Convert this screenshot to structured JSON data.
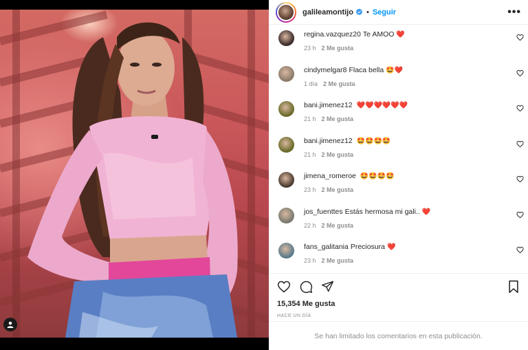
{
  "post": {
    "username": "galileamontijo",
    "separator": "•",
    "follow_label": "Seguir",
    "more_label": "•••"
  },
  "comments": [
    {
      "user": "regina.vazquez20",
      "text": "Te AMOO",
      "emoji": "❤️",
      "time": "23 h",
      "likes": "2 Me gusta",
      "avatar_color": "#3b2a2a"
    },
    {
      "user": "cindymelgar8",
      "text": "Flaca bella",
      "emoji": "🤩❤️",
      "time": "1 día",
      "likes": "2 Me gusta",
      "avatar_color": "#8b7b6a"
    },
    {
      "user": "bani.jimenez12",
      "text": "",
      "emoji": "❤️❤️❤️❤️❤️❤️",
      "time": "21 h",
      "likes": "2 Me gusta",
      "avatar_color": "#6b6b2a"
    },
    {
      "user": "bani.jimenez12",
      "text": "",
      "emoji": "🤩🤩🤩🤩",
      "time": "21 h",
      "likes": "2 Me gusta",
      "avatar_color": "#6b6b2a"
    },
    {
      "user": "jimena_romeroe",
      "text": "",
      "emoji": "🤩🤩🤩🤩",
      "time": "23 h",
      "likes": "2 Me gusta",
      "avatar_color": "#4a3a30"
    },
    {
      "user": "jos_fuenttes",
      "text": "Estás hermosa mi gali..",
      "emoji": "❤️",
      "time": "22 h",
      "likes": "2 Me gusta",
      "avatar_color": "#7a7a70"
    },
    {
      "user": "fans_galitania",
      "text": "Preciosura",
      "emoji": "❤️",
      "time": "23 h",
      "likes": "2 Me gusta",
      "avatar_color": "#5a7a8a"
    }
  ],
  "footer": {
    "likes_count": "15,354 Me gusta",
    "posted_ago": "HACE UN DÍA",
    "comments_limited": "Se han limitado los comentarios en esta publicación."
  },
  "icons": {
    "like": "heart-icon",
    "comment": "comment-icon",
    "share": "paper-plane-icon",
    "save": "bookmark-icon",
    "tagged": "user-tag-icon",
    "verified": "verified-badge-icon"
  },
  "colors": {
    "accent": "#0095f6",
    "muted": "#8e8e8e",
    "divider": "#efefef"
  }
}
